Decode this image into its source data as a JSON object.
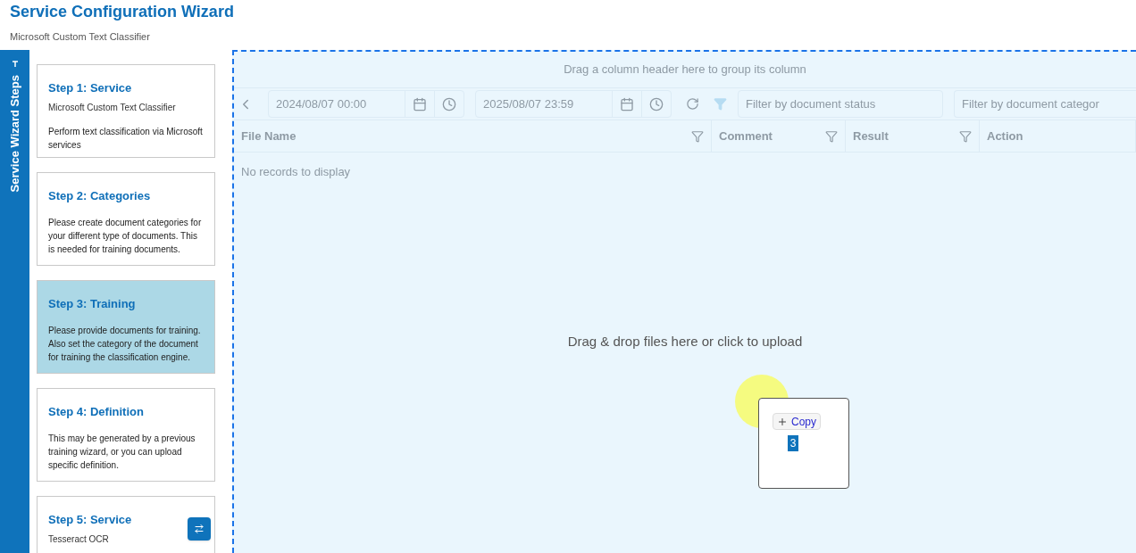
{
  "header": {
    "title": "Service Configuration Wizard",
    "subtitle": "Microsoft Custom Text Classifier"
  },
  "side_tab": {
    "label": "Service Wizard Steps"
  },
  "steps": [
    {
      "title": "Step 1: Service",
      "subtitle": "Microsoft Custom Text Classifier",
      "description": "Perform text classification via Microsoft services",
      "selected": false
    },
    {
      "title": "Step 2: Categories",
      "description": "Please create document categories for your different type of documents. This is needed for training documents.",
      "selected": false
    },
    {
      "title": "Step 3: Training",
      "description": "Please provide documents for training. Also set the category of the document for training the classification engine.",
      "selected": true
    },
    {
      "title": "Step 4: Definition",
      "description": "This may be generated by a previous training wizard, or you can upload specific definition.",
      "selected": false
    },
    {
      "title": "Step 5: Service",
      "subtitle": "Tesseract OCR",
      "selected": false
    }
  ],
  "grid": {
    "group_hint": "Drag a column header here to group its column",
    "date_from": "2024/08/07 00:00",
    "date_to": "2025/08/07 23:59",
    "status_filter": {
      "placeholder": "Filter by document status"
    },
    "category_filter": {
      "placeholder": "Filter by document categor"
    },
    "columns": [
      {
        "label": "File Name",
        "filterable": true
      },
      {
        "label": "Comment",
        "filterable": true
      },
      {
        "label": "Result",
        "filterable": true
      },
      {
        "label": "Action",
        "filterable": false
      }
    ],
    "empty_text": "No records to display"
  },
  "upload_hint": "Drag & drop files here or click to upload",
  "drag_preview": {
    "action": "Copy",
    "count": "3"
  }
}
